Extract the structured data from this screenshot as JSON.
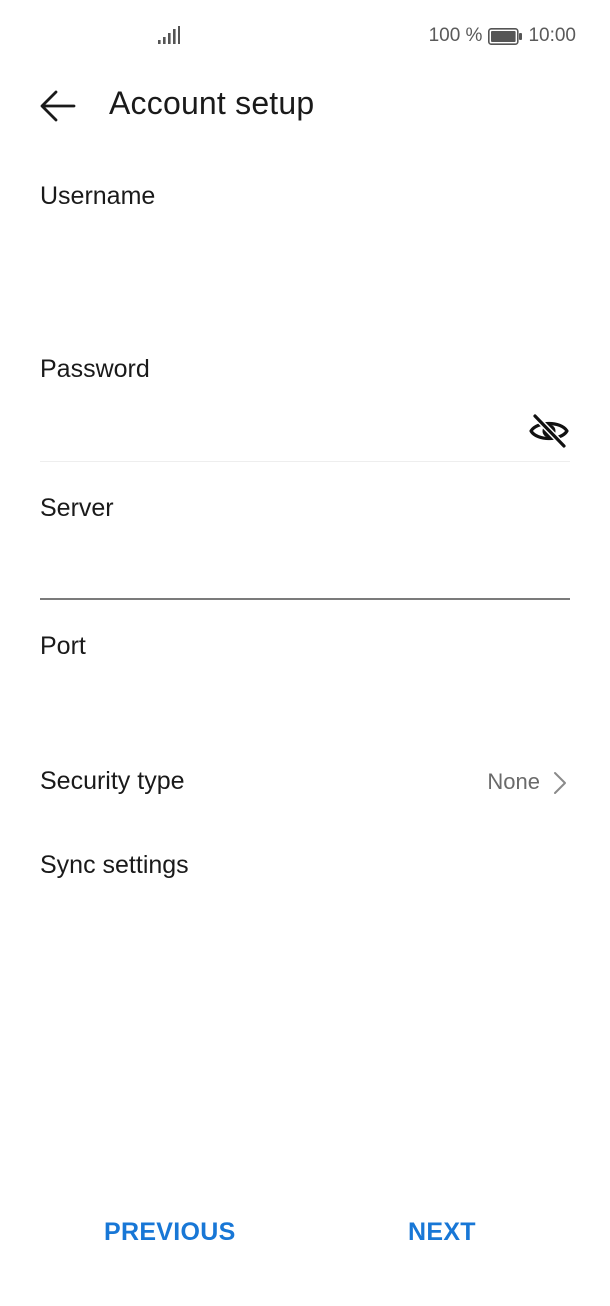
{
  "status_bar": {
    "signal_icon": "signal-bars-icon",
    "battery_percent": "100 %",
    "battery_icon": "battery-full-icon",
    "time": "10:00"
  },
  "header": {
    "back_icon": "arrow-left-icon",
    "title": "Account setup"
  },
  "form": {
    "username": {
      "label": "Username",
      "value": ""
    },
    "password": {
      "label": "Password",
      "value": "",
      "toggle_icon": "eye-off-icon"
    },
    "server": {
      "label": "Server",
      "value": ""
    },
    "port": {
      "label": "Port",
      "value": ""
    }
  },
  "settings": {
    "security_type": {
      "label": "Security type",
      "value": "None",
      "icon": "chevron-right-icon"
    },
    "sync_settings": {
      "label": "Sync settings"
    }
  },
  "footer": {
    "previous_label": "PREVIOUS",
    "next_label": "NEXT"
  },
  "colors": {
    "accent": "#1877d6",
    "text": "#1a1a1a",
    "secondary_text": "#6a6a6a",
    "active_underline": "#7b7b7b"
  }
}
